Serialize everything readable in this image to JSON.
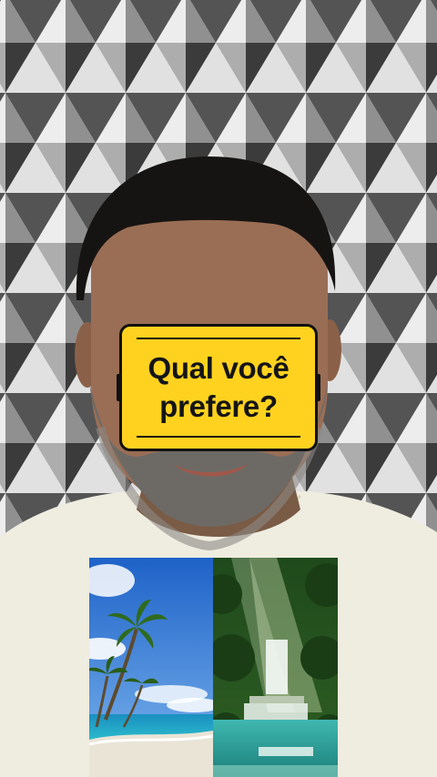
{
  "video": {
    "question_line1": "Qual você",
    "question_line2": "prefere?"
  },
  "options": [
    {
      "name": "beach-option",
      "icon": "beach-palm-image"
    },
    {
      "name": "waterfall-option",
      "icon": "forest-waterfall-image"
    }
  ],
  "colors": {
    "card_yellow": "#ffd21f",
    "card_outline": "#111111",
    "shirt": "#efece0",
    "wall_dark": "#3c3c3c",
    "wall_light": "#e4e4e4"
  }
}
